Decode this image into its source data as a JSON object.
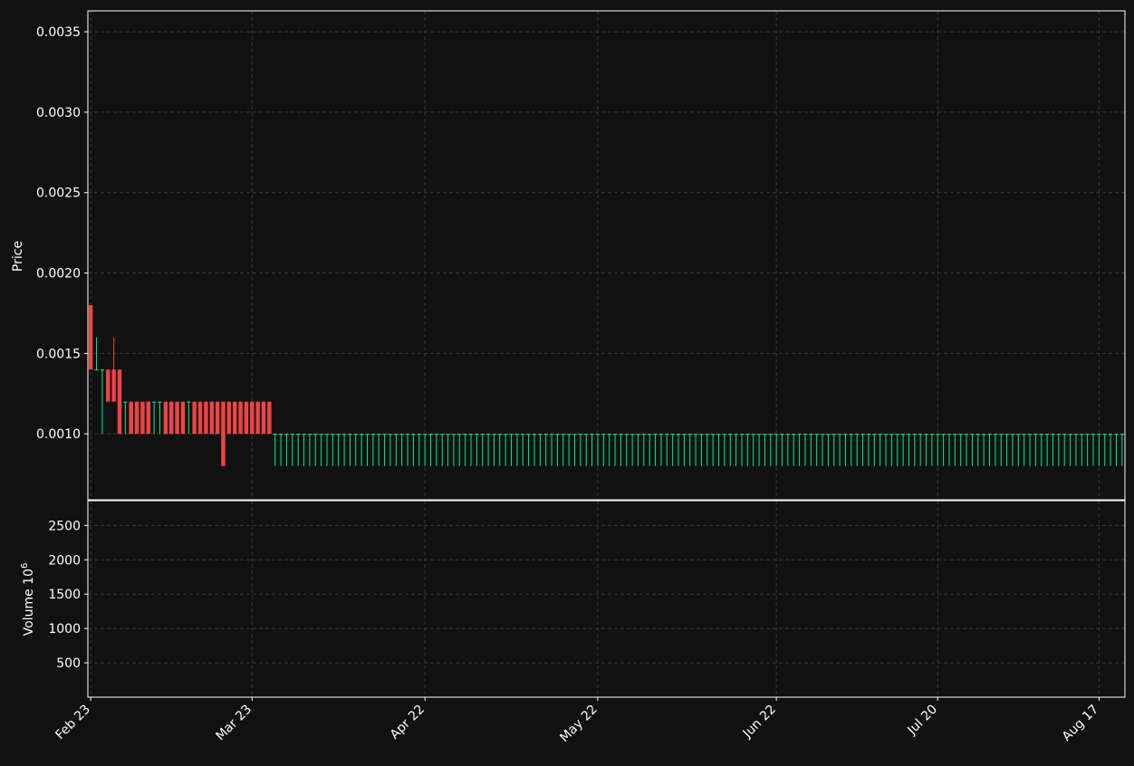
{
  "colors": {
    "background": "#111111",
    "frame": "#ffffff",
    "grid": "#3a3a3a",
    "up": "#00ee88",
    "down": "#ee4444",
    "ma_thick": "#33eeff",
    "ma_thin": "#55cccc",
    "band": "#ffaa00",
    "text": "#ffffff"
  },
  "chart_data": [
    {
      "type": "candlestick",
      "ylabel": "Price",
      "ylim": [
        0.00059,
        0.00363
      ],
      "yticks": [
        0.001,
        0.0015,
        0.002,
        0.0025,
        0.003,
        0.0035
      ],
      "ytick_labels": [
        "0.0010",
        "0.0015",
        "0.0020",
        "0.0025",
        "0.0030",
        "0.0035"
      ],
      "x": [
        "Feb 23",
        "Feb 24",
        "Feb 25",
        "Feb 26",
        "Feb 27",
        "Feb 28",
        "Mar 1",
        "Mar 2",
        "Mar 3",
        "Mar 4",
        "Mar 5",
        "Mar 6",
        "Mar 7",
        "Mar 8",
        "Mar 9",
        "Mar 10",
        "Mar 11",
        "Mar 12",
        "Mar 13",
        "Mar 14",
        "Mar 15",
        "Mar 16",
        "Mar 17",
        "Mar 18",
        "Mar 19",
        "Mar 20",
        "Mar 21",
        "Mar 22",
        "Mar 23",
        "Mar 24",
        "Mar 25",
        "Mar 26",
        "Mar 27",
        "Mar 28",
        "Mar 29",
        "Mar 30",
        "Mar 31",
        "Apr 1",
        "Apr 2",
        "Apr 3",
        "Apr 4",
        "Apr 5",
        "Apr 6",
        "Apr 7",
        "Apr 8",
        "Apr 9",
        "Apr 10",
        "Apr 11",
        "Apr 12",
        "Apr 13",
        "Apr 14",
        "Apr 15",
        "Apr 16",
        "Apr 17",
        "Apr 18",
        "Apr 19",
        "Apr 20",
        "Apr 21",
        "Apr 22",
        "Apr 23",
        "Apr 24",
        "Apr 25",
        "Apr 26",
        "Apr 27",
        "Apr 28",
        "Apr 29",
        "Apr 30",
        "May 1",
        "May 2",
        "May 3",
        "May 4",
        "May 5",
        "May 6",
        "May 7",
        "May 8",
        "May 9",
        "May 10",
        "May 11",
        "May 12",
        "May 13",
        "May 14",
        "May 15",
        "May 16",
        "May 17",
        "May 18",
        "May 19",
        "May 20",
        "May 21",
        "May 22",
        "May 23",
        "May 24",
        "May 25",
        "May 26",
        "May 27",
        "May 28",
        "May 29",
        "May 30",
        "May 31",
        "Jun 1",
        "Jun 2",
        "Jun 3",
        "Jun 4",
        "Jun 5",
        "Jun 6",
        "Jun 7",
        "Jun 8",
        "Jun 9",
        "Jun 10",
        "Jun 11",
        "Jun 12",
        "Jun 13",
        "Jun 14",
        "Jun 15",
        "Jun 16",
        "Jun 17",
        "Jun 18",
        "Jun 19",
        "Jun 20",
        "Jun 21",
        "Jun 22",
        "Jun 23",
        "Jun 24",
        "Jun 25",
        "Jun 26",
        "Jun 27",
        "Jun 28",
        "Jun 29",
        "Jun 30",
        "Jul 1",
        "Jul 2",
        "Jul 3",
        "Jul 4",
        "Jul 5",
        "Jul 6",
        "Jul 7",
        "Jul 8",
        "Jul 9",
        "Jul 10",
        "Jul 11",
        "Jul 12",
        "Jul 13",
        "Jul 14",
        "Jul 15",
        "Jul 16",
        "Jul 17",
        "Jul 18",
        "Jul 19",
        "Jul 20",
        "Jul 21",
        "Jul 22",
        "Jul 23",
        "Jul 24",
        "Jul 25",
        "Jul 26",
        "Jul 27",
        "Jul 28",
        "Jul 29",
        "Jul 30",
        "Jul 31",
        "Aug 1",
        "Aug 2",
        "Aug 3",
        "Aug 4",
        "Aug 5",
        "Aug 6",
        "Aug 7",
        "Aug 8",
        "Aug 9",
        "Aug 10",
        "Aug 11",
        "Aug 12",
        "Aug 13",
        "Aug 14",
        "Aug 15",
        "Aug 16",
        "Aug 17",
        "Aug 18",
        "Aug 19",
        "Aug 20"
      ],
      "xtick_labels": [
        "Feb 23",
        "Mar 23",
        "Apr 22",
        "May 22",
        "Jun 22",
        "Jul 20",
        "Aug 17"
      ],
      "open": [
        0.0018,
        0.0014,
        0.0014,
        0.0014,
        0.0014,
        0.0014,
        0.0012,
        0.0012,
        0.0012,
        0.0012,
        0.0012,
        0.0012,
        0.0012,
        0.0012,
        0.0012,
        0.0012,
        0.0012,
        0.0012,
        0.0012,
        0.0012,
        0.0012,
        0.0012,
        0.0012,
        0.0012,
        0.0012,
        0.0012,
        0.0012,
        0.0012,
        0.0012,
        0.0012,
        0.0012,
        0.0012,
        0.001,
        0.001,
        0.001,
        0.001,
        0.001,
        0.001,
        0.001,
        0.001,
        0.001,
        0.001,
        0.001,
        0.001,
        0.001,
        0.001,
        0.001,
        0.001,
        0.001,
        0.001,
        0.001,
        0.001,
        0.001,
        0.001,
        0.001,
        0.001,
        0.001,
        0.001,
        0.001,
        0.001,
        0.001,
        0.001,
        0.001,
        0.001,
        0.001,
        0.001,
        0.001,
        0.001,
        0.001,
        0.001,
        0.001,
        0.001,
        0.001,
        0.001,
        0.001,
        0.001,
        0.001,
        0.001,
        0.001,
        0.001,
        0.001,
        0.001,
        0.001,
        0.001,
        0.001,
        0.001,
        0.001,
        0.001,
        0.001,
        0.001,
        0.001,
        0.001,
        0.001,
        0.001,
        0.001,
        0.001,
        0.001,
        0.001,
        0.001,
        0.001,
        0.001,
        0.001,
        0.001,
        0.001,
        0.001,
        0.001,
        0.001,
        0.001,
        0.001,
        0.001,
        0.001,
        0.001,
        0.001,
        0.001,
        0.001,
        0.001,
        0.001,
        0.001,
        0.001,
        0.001,
        0.001,
        0.001,
        0.001,
        0.001,
        0.001,
        0.001,
        0.001,
        0.001,
        0.001,
        0.001,
        0.001,
        0.001,
        0.001,
        0.001,
        0.001,
        0.001,
        0.001,
        0.001,
        0.001,
        0.001,
        0.001,
        0.001,
        0.001,
        0.001,
        0.001,
        0.001,
        0.001,
        0.001,
        0.001,
        0.001,
        0.001,
        0.001,
        0.001,
        0.001,
        0.001,
        0.001,
        0.001,
        0.001,
        0.001,
        0.001,
        0.001,
        0.001,
        0.001,
        0.001,
        0.001,
        0.001,
        0.001,
        0.001,
        0.001,
        0.001,
        0.001,
        0.001,
        0.001,
        0.001,
        0.001,
        0.001,
        0.001,
        0.001,
        0.001,
        0.001,
        0.001,
        0.001
      ],
      "high": [
        0.0018,
        0.0016,
        0.0014,
        0.0014,
        0.0016,
        0.0014,
        0.0012,
        0.0012,
        0.0012,
        0.0012,
        0.0012,
        0.0012,
        0.0012,
        0.0012,
        0.0012,
        0.0012,
        0.0012,
        0.0012,
        0.0012,
        0.0012,
        0.0012,
        0.0012,
        0.0012,
        0.0012,
        0.0012,
        0.0012,
        0.0012,
        0.0012,
        0.0012,
        0.0012,
        0.0012,
        0.0012,
        0.001,
        0.001,
        0.001,
        0.001,
        0.001,
        0.001,
        0.001,
        0.001,
        0.001,
        0.001,
        0.001,
        0.001,
        0.001,
        0.001,
        0.001,
        0.001,
        0.001,
        0.001,
        0.001,
        0.001,
        0.001,
        0.001,
        0.001,
        0.001,
        0.001,
        0.001,
        0.001,
        0.001,
        0.001,
        0.001,
        0.001,
        0.001,
        0.001,
        0.001,
        0.001,
        0.001,
        0.001,
        0.001,
        0.001,
        0.001,
        0.001,
        0.001,
        0.001,
        0.001,
        0.001,
        0.001,
        0.001,
        0.001,
        0.001,
        0.001,
        0.001,
        0.001,
        0.001,
        0.001,
        0.001,
        0.001,
        0.001,
        0.001,
        0.001,
        0.001,
        0.001,
        0.001,
        0.001,
        0.001,
        0.001,
        0.001,
        0.001,
        0.001,
        0.001,
        0.001,
        0.001,
        0.001,
        0.001,
        0.001,
        0.001,
        0.001,
        0.001,
        0.001,
        0.001,
        0.001,
        0.001,
        0.001,
        0.001,
        0.001,
        0.001,
        0.001,
        0.001,
        0.001,
        0.001,
        0.001,
        0.001,
        0.001,
        0.001,
        0.001,
        0.001,
        0.001,
        0.001,
        0.001,
        0.001,
        0.001,
        0.001,
        0.001,
        0.001,
        0.001,
        0.001,
        0.001,
        0.001,
        0.001,
        0.001,
        0.001,
        0.001,
        0.001,
        0.001,
        0.001,
        0.001,
        0.001,
        0.001,
        0.001,
        0.001,
        0.001,
        0.001,
        0.001,
        0.001,
        0.001,
        0.001,
        0.001,
        0.001,
        0.001,
        0.001,
        0.001,
        0.001,
        0.001,
        0.001,
        0.001,
        0.001,
        0.001,
        0.001,
        0.001,
        0.001,
        0.001,
        0.001,
        0.001,
        0.001,
        0.001,
        0.001,
        0.001,
        0.001,
        0.001
      ],
      "low": [
        0.0014,
        0.0014,
        0.001,
        0.0014,
        0.0012,
        0.001,
        0.001,
        0.001,
        0.001,
        0.001,
        0.001,
        0.001,
        0.001,
        0.001,
        0.001,
        0.001,
        0.001,
        0.001,
        0.001,
        0.001,
        0.001,
        0.001,
        0.001,
        0.001,
        0.001,
        0.001,
        0.001,
        0.001,
        0.001,
        0.001,
        0.001,
        0.001,
        0.0008,
        0.0008,
        0.0008,
        0.0008,
        0.0008,
        0.0008,
        0.0008,
        0.0008,
        0.0008,
        0.0008,
        0.0008,
        0.0008,
        0.0008,
        0.0008,
        0.0008,
        0.0008,
        0.0008,
        0.0008,
        0.0008,
        0.0008,
        0.0008,
        0.0008,
        0.0008,
        0.0008,
        0.0008,
        0.0008,
        0.0008,
        0.0008,
        0.0008,
        0.0008,
        0.0008,
        0.0008,
        0.0008,
        0.0008,
        0.0008,
        0.0008,
        0.0008,
        0.0008,
        0.0008,
        0.0008,
        0.0008,
        0.0008,
        0.0008,
        0.0008,
        0.0008,
        0.0008,
        0.0008,
        0.0008,
        0.0008,
        0.0008,
        0.0008,
        0.0008,
        0.0008,
        0.0008,
        0.0008,
        0.0008,
        0.0008,
        0.0008,
        0.0008,
        0.0008,
        0.0008,
        0.0008,
        0.0008,
        0.0008,
        0.0008,
        0.0008,
        0.0008,
        0.0008,
        0.0008,
        0.0008,
        0.0008,
        0.0008,
        0.0008,
        0.0008,
        0.0008,
        0.0008,
        0.0008,
        0.0008,
        0.0008,
        0.0008,
        0.0008,
        0.0008,
        0.0008,
        0.0008,
        0.0008,
        0.0008,
        0.0008,
        0.0008,
        0.0008,
        0.0008,
        0.0008,
        0.0008,
        0.0008,
        0.0008,
        0.0008,
        0.0008,
        0.0008,
        0.0008,
        0.0008,
        0.0008,
        0.0008,
        0.0008,
        0.0008,
        0.0008,
        0.0008,
        0.0008,
        0.0008,
        0.0008,
        0.0008,
        0.0008,
        0.0008,
        0.0008,
        0.0008,
        0.0008,
        0.0008,
        0.0008,
        0.0008,
        0.0008,
        0.0008,
        0.0008,
        0.0008,
        0.0008,
        0.0008,
        0.0008,
        0.0008,
        0.0008,
        0.0008,
        0.0008,
        0.0008,
        0.0008,
        0.0008,
        0.0008,
        0.0008,
        0.0008,
        0.0008,
        0.0008,
        0.0008,
        0.0008,
        0.0008,
        0.0008,
        0.0008,
        0.0008,
        0.0008,
        0.0008,
        0.0008,
        0.0008,
        0.0008,
        0.0008,
        0.0008
      ],
      "close": [
        0.0014,
        0.0014,
        0.0014,
        0.0012,
        0.0012,
        0.001,
        0.0012,
        0.001,
        0.001,
        0.001,
        0.001,
        0.0012,
        0.0012,
        0.001,
        0.001,
        0.001,
        0.001,
        0.0012,
        0.001,
        0.001,
        0.001,
        0.001,
        0.001,
        0.0008,
        0.001,
        0.001,
        0.001,
        0.001,
        0.001,
        0.001,
        0.001,
        0.001,
        0.001,
        0.001,
        0.001,
        0.001,
        0.001,
        0.001,
        0.001,
        0.001,
        0.001,
        0.001,
        0.001,
        0.001,
        0.001,
        0.001,
        0.001,
        0.001,
        0.001,
        0.001,
        0.001,
        0.001,
        0.001,
        0.001,
        0.001,
        0.001,
        0.001,
        0.001,
        0.001,
        0.001,
        0.001,
        0.001,
        0.001,
        0.001,
        0.001,
        0.001,
        0.001,
        0.001,
        0.001,
        0.001,
        0.001,
        0.001,
        0.001,
        0.001,
        0.001,
        0.001,
        0.001,
        0.001,
        0.001,
        0.001,
        0.001,
        0.001,
        0.001,
        0.001,
        0.001,
        0.001,
        0.001,
        0.001,
        0.001,
        0.001,
        0.001,
        0.001,
        0.001,
        0.001,
        0.001,
        0.001,
        0.001,
        0.001,
        0.001,
        0.001,
        0.001,
        0.001,
        0.001,
        0.001,
        0.001,
        0.001,
        0.001,
        0.001,
        0.001,
        0.001,
        0.001,
        0.001,
        0.001,
        0.001,
        0.001,
        0.001,
        0.001,
        0.001,
        0.001,
        0.001,
        0.001,
        0.001,
        0.001,
        0.001,
        0.001,
        0.001,
        0.001,
        0.001,
        0.001,
        0.001,
        0.001,
        0.001,
        0.001,
        0.001,
        0.001,
        0.001,
        0.001,
        0.001,
        0.001,
        0.001,
        0.001,
        0.001,
        0.001,
        0.001,
        0.001,
        0.001,
        0.001,
        0.001,
        0.001,
        0.001,
        0.001,
        0.001,
        0.001,
        0.001,
        0.001,
        0.001,
        0.001,
        0.001,
        0.001,
        0.001,
        0.001,
        0.001,
        0.001,
        0.001,
        0.001,
        0.001,
        0.001,
        0.001,
        0.001,
        0.001,
        0.001,
        0.001,
        0.001,
        0.001,
        0.001,
        0.001,
        0.001,
        0.001,
        0.001,
        0.001
      ]
    },
    {
      "type": "bar",
      "ylabel": "Volume  10",
      "ylabel_exponent": "6",
      "ylim": [
        0,
        2860
      ],
      "yticks": [
        500,
        1000,
        1500,
        2000,
        2500
      ],
      "ytick_labels": [
        "500",
        "1000",
        "1500",
        "2000",
        "2500"
      ]
    }
  ]
}
